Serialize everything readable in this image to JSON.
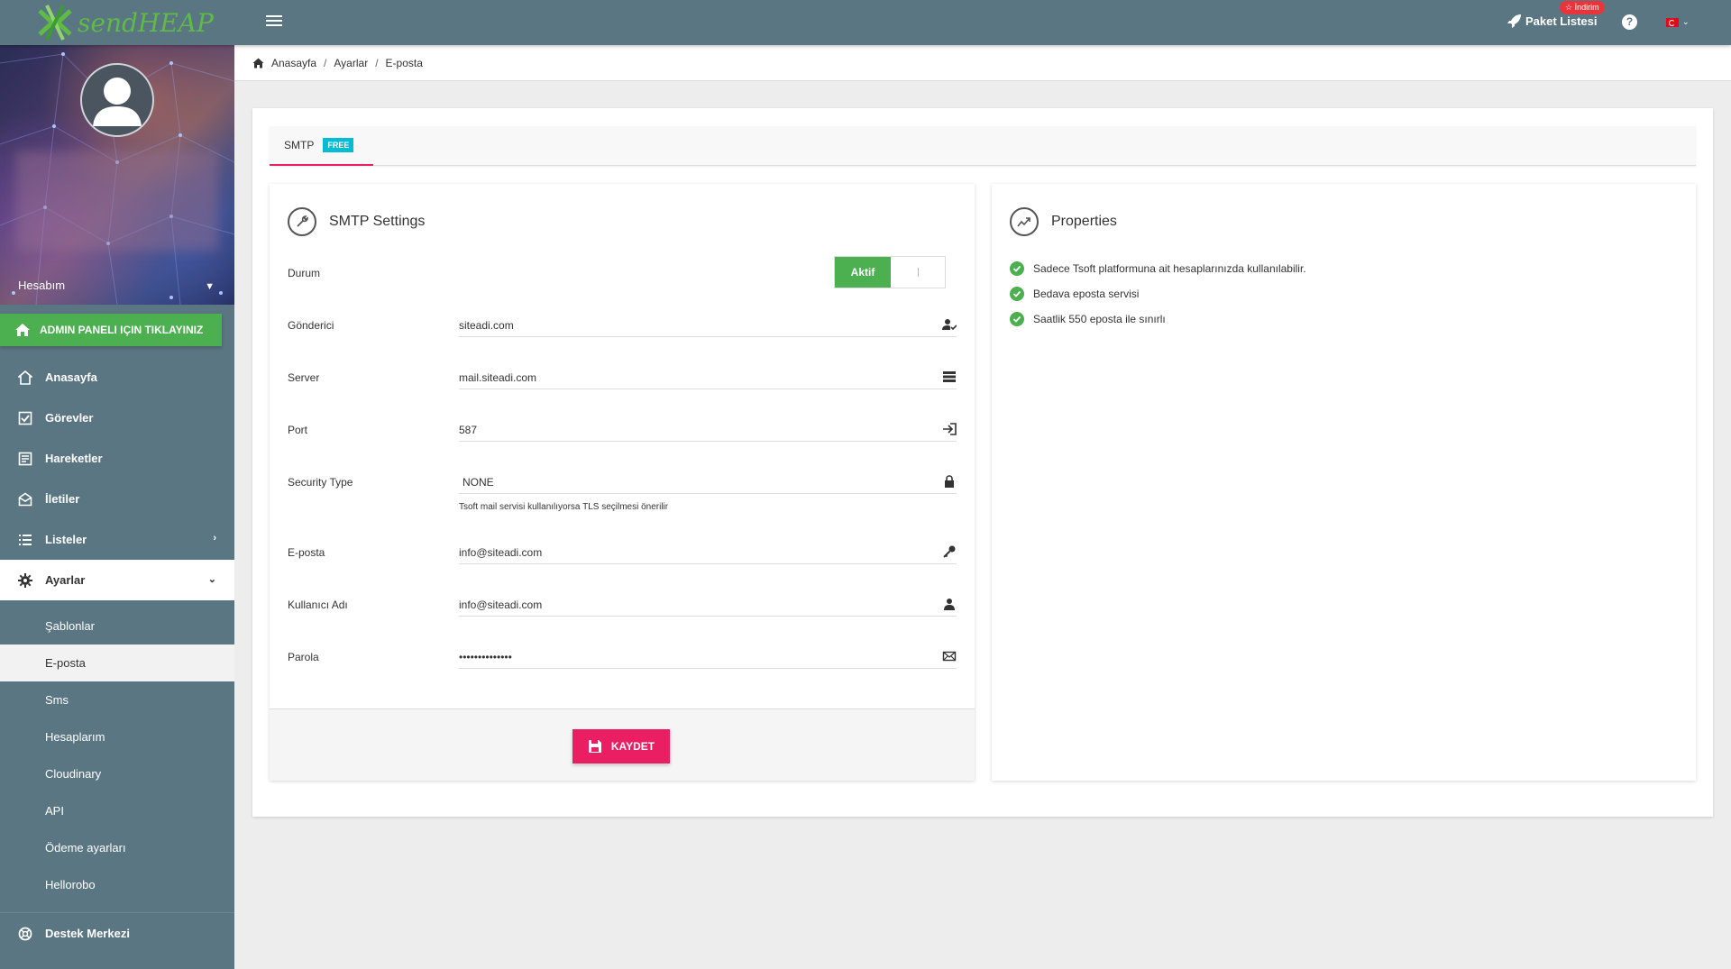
{
  "brand": {
    "logo_text": "sendHEAP",
    "color": "#5dbb46"
  },
  "topbar": {
    "background": "#5a7682",
    "package_label": "Paket Listesi",
    "discount_badge": "☆ İndirim",
    "help_glyph": "?"
  },
  "sidebar": {
    "account_label": "Hesabım",
    "admin_button": "ADMIN PANELI IÇIN TIKLAYINIZ",
    "items": [
      {
        "label": "Anasayfa",
        "icon": "home-icon"
      },
      {
        "label": "Görevler",
        "icon": "tasks-icon"
      },
      {
        "label": "Hareketler",
        "icon": "activity-icon"
      },
      {
        "label": "İletiler",
        "icon": "messages-icon"
      },
      {
        "label": "Listeler",
        "icon": "list-icon"
      },
      {
        "label": "Ayarlar",
        "icon": "gear-icon"
      }
    ],
    "sub_items": [
      {
        "label": "Şablonlar"
      },
      {
        "label": "E-posta"
      },
      {
        "label": "Sms"
      },
      {
        "label": "Hesaplarım"
      },
      {
        "label": "Cloudinary"
      },
      {
        "label": "API"
      },
      {
        "label": "Ödeme ayarları"
      },
      {
        "label": "Hellorobo"
      }
    ],
    "support_label": "Destek Merkezi"
  },
  "breadcrumb": {
    "home": "Anasayfa",
    "level1": "Ayarlar",
    "level2": "E-posta"
  },
  "tabs": {
    "smtp_label": "SMTP",
    "free_badge": "FREE"
  },
  "smtp": {
    "title": "SMTP Settings",
    "status_label": "Durum",
    "status_on": "Aktif",
    "sender_label": "Gönderici",
    "sender_value": "siteadi.com",
    "server_label": "Server",
    "server_value": "mail.siteadi.com",
    "port_label": "Port",
    "port_value": "587",
    "security_label": "Security Type",
    "security_value": "NONE",
    "security_hint": "Tsoft mail servisi kullanılıyorsa TLS seçilmesi önerilir",
    "email_label": "E-posta",
    "email_value": "info@siteadi.com",
    "username_label": "Kullanıcı Adı",
    "username_value": "info@siteadi.com",
    "password_label": "Parola",
    "password_value": "••••••••••••••",
    "save_label": "KAYDET"
  },
  "properties": {
    "title": "Properties",
    "items": [
      "Sadece Tsoft platformuna ait hesaplarınızda kullanılabilir.",
      "Bedava eposta servisi",
      "Saatlik 550 eposta ile sınırlı"
    ]
  },
  "colors": {
    "accent": "#e91e63",
    "success": "#4caf50",
    "info": "#00bcd4"
  }
}
